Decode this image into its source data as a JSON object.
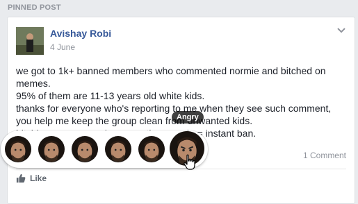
{
  "pinned_label": "PINNED POST",
  "post": {
    "author": "Avishay Robi",
    "date": "4 June",
    "lines": [
      "we got to 1k+ banned members who commented normie and bitched on",
      "memes.",
      "95% of them are 11-13 years old white kids.",
      "thanks for everyone who's reporting to me when they see such comment,",
      "you help me keep the group clean from unwanted kids.",
      "bitching on a meme / commenting normie = instant ban."
    ]
  },
  "comments_count": "1 Comment",
  "like_label": "Like",
  "tooltip": "Angry",
  "reactions": [
    "reaction-1",
    "reaction-2",
    "reaction-3",
    "reaction-4",
    "reaction-5",
    "reaction-angry"
  ],
  "icons": {
    "chevron": "chevron-down-icon",
    "like": "thumbs-up-icon",
    "cursor": "hand-pointer-icon"
  },
  "colors": {
    "author": "#365899",
    "meta": "#90949c",
    "text": "#1d2129",
    "background": "#e9ebee"
  }
}
